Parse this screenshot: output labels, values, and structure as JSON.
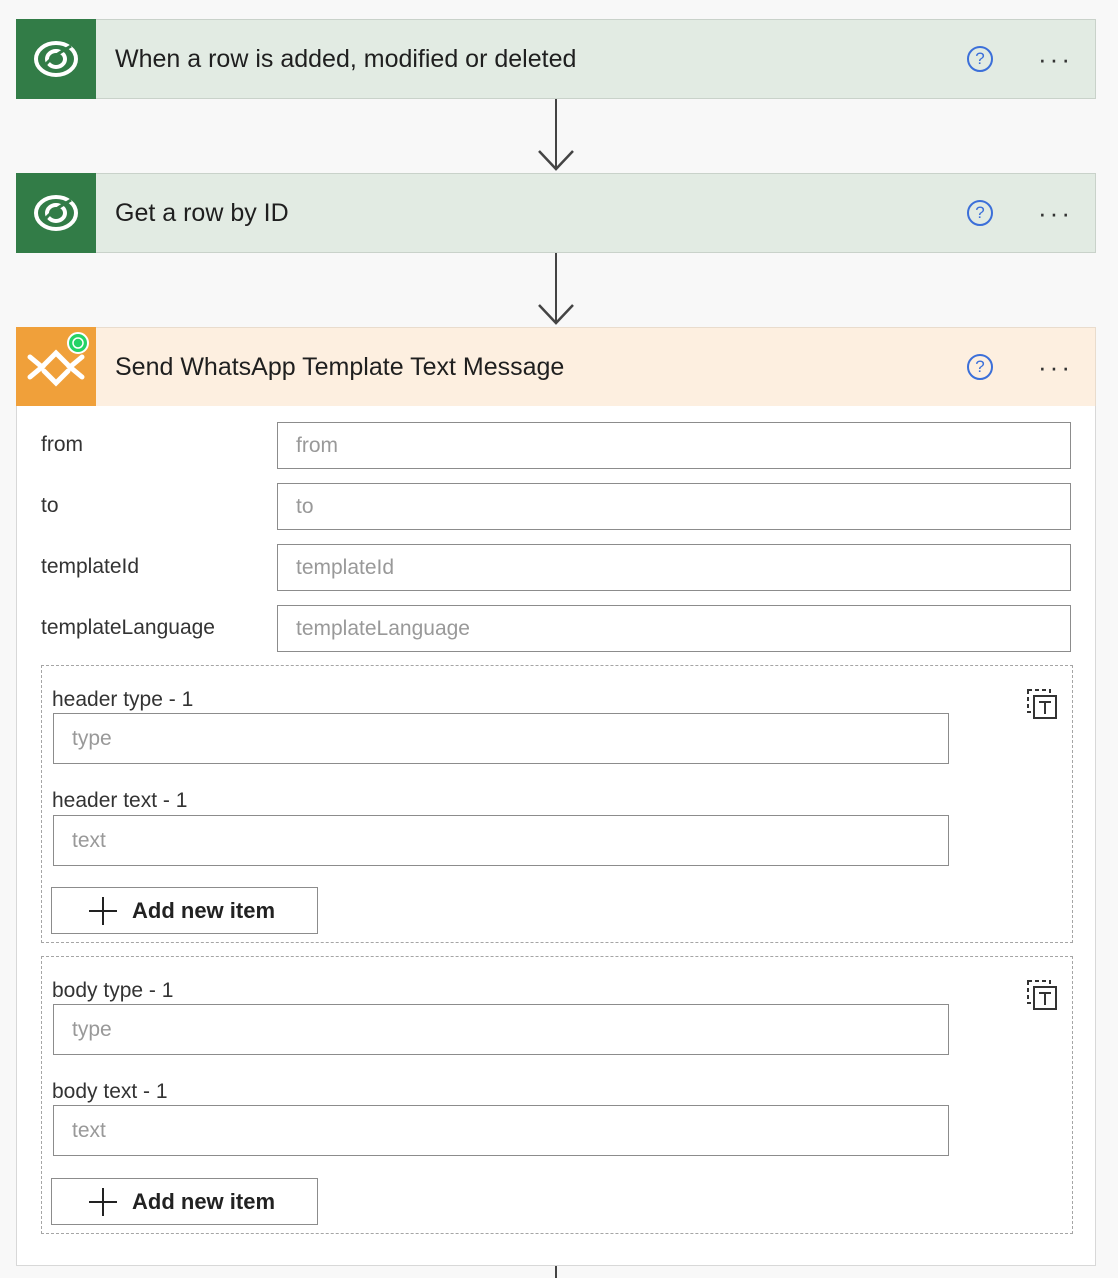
{
  "steps": [
    {
      "title": "When a row is added, modified or deleted"
    },
    {
      "title": "Get a row by ID"
    },
    {
      "title": "Send WhatsApp Template Text Message"
    }
  ],
  "help_symbol": "?",
  "more_symbol": "···",
  "fields": [
    {
      "label": "from",
      "placeholder": "from"
    },
    {
      "label": "to",
      "placeholder": "to"
    },
    {
      "label": "templateId",
      "placeholder": "templateId"
    },
    {
      "label": "templateLanguage",
      "placeholder": "templateLanguage"
    }
  ],
  "header_group": {
    "type_label": "header type - 1",
    "type_placeholder": "type",
    "text_label": "header text - 1",
    "text_placeholder": "text",
    "add_label": "Add new item"
  },
  "body_group": {
    "type_label": "body type - 1",
    "type_placeholder": "type",
    "text_label": "body text - 1",
    "text_placeholder": "text",
    "add_label": "Add new item"
  },
  "colors": {
    "dataverse_green": "#327c47",
    "connector_orange": "#f0a03a",
    "whatsapp_green": "#25d366",
    "help_blue": "#3b6fd9"
  }
}
